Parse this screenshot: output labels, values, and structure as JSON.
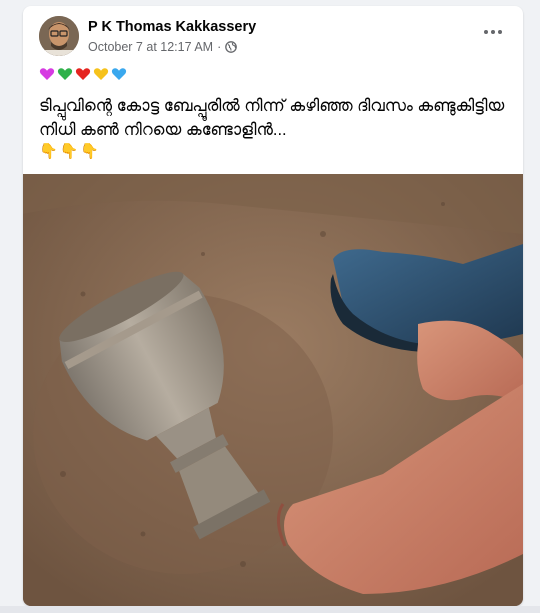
{
  "post": {
    "author": "P K Thomas Kakkassery",
    "date": "October 7 at 12:17 AM",
    "separator": "·",
    "privacy_icon": "globe-icon",
    "more_icon": "more-options-icon",
    "hearts": [
      {
        "name": "purple-heart-icon",
        "color": "#d63be2"
      },
      {
        "name": "green-heart-icon",
        "color": "#2fb14a"
      },
      {
        "name": "red-heart-icon",
        "color": "#e5241f"
      },
      {
        "name": "yellow-heart-icon",
        "color": "#f6c21b"
      },
      {
        "name": "blue-heart-icon",
        "color": "#3aa8ee"
      }
    ],
    "text": "ടിപ്പുവിന്റെ കോട്ട ബേപ്പൂരിൽ നിന്ന് കഴിഞ്ഞ ദിവസം കണ്ടുകിട്ടിയ നിധി കൺ നിറയെ കണ്ടോളിൻ...",
    "pointers": [
      "👇",
      "👇",
      "👇"
    ],
    "photo_icon": "post-photo-image"
  }
}
